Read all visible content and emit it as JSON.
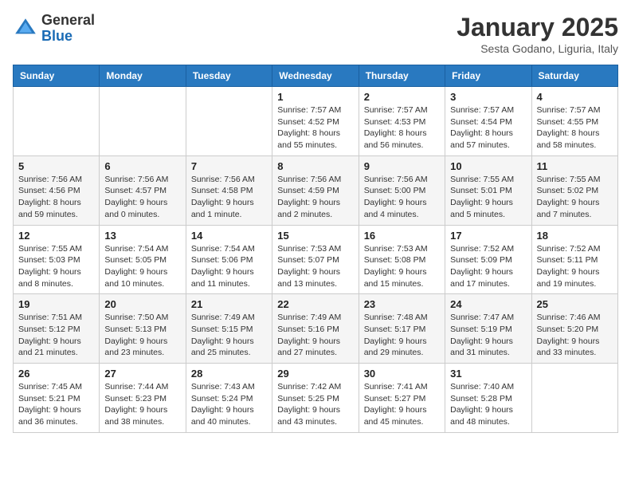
{
  "header": {
    "logo_general": "General",
    "logo_blue": "Blue",
    "month_title": "January 2025",
    "location": "Sesta Godano, Liguria, Italy"
  },
  "weekdays": [
    "Sunday",
    "Monday",
    "Tuesday",
    "Wednesday",
    "Thursday",
    "Friday",
    "Saturday"
  ],
  "weeks": [
    [
      {
        "day": "",
        "info": ""
      },
      {
        "day": "",
        "info": ""
      },
      {
        "day": "",
        "info": ""
      },
      {
        "day": "1",
        "info": "Sunrise: 7:57 AM\nSunset: 4:52 PM\nDaylight: 8 hours\nand 55 minutes."
      },
      {
        "day": "2",
        "info": "Sunrise: 7:57 AM\nSunset: 4:53 PM\nDaylight: 8 hours\nand 56 minutes."
      },
      {
        "day": "3",
        "info": "Sunrise: 7:57 AM\nSunset: 4:54 PM\nDaylight: 8 hours\nand 57 minutes."
      },
      {
        "day": "4",
        "info": "Sunrise: 7:57 AM\nSunset: 4:55 PM\nDaylight: 8 hours\nand 58 minutes."
      }
    ],
    [
      {
        "day": "5",
        "info": "Sunrise: 7:56 AM\nSunset: 4:56 PM\nDaylight: 8 hours\nand 59 minutes."
      },
      {
        "day": "6",
        "info": "Sunrise: 7:56 AM\nSunset: 4:57 PM\nDaylight: 9 hours\nand 0 minutes."
      },
      {
        "day": "7",
        "info": "Sunrise: 7:56 AM\nSunset: 4:58 PM\nDaylight: 9 hours\nand 1 minute."
      },
      {
        "day": "8",
        "info": "Sunrise: 7:56 AM\nSunset: 4:59 PM\nDaylight: 9 hours\nand 2 minutes."
      },
      {
        "day": "9",
        "info": "Sunrise: 7:56 AM\nSunset: 5:00 PM\nDaylight: 9 hours\nand 4 minutes."
      },
      {
        "day": "10",
        "info": "Sunrise: 7:55 AM\nSunset: 5:01 PM\nDaylight: 9 hours\nand 5 minutes."
      },
      {
        "day": "11",
        "info": "Sunrise: 7:55 AM\nSunset: 5:02 PM\nDaylight: 9 hours\nand 7 minutes."
      }
    ],
    [
      {
        "day": "12",
        "info": "Sunrise: 7:55 AM\nSunset: 5:03 PM\nDaylight: 9 hours\nand 8 minutes."
      },
      {
        "day": "13",
        "info": "Sunrise: 7:54 AM\nSunset: 5:05 PM\nDaylight: 9 hours\nand 10 minutes."
      },
      {
        "day": "14",
        "info": "Sunrise: 7:54 AM\nSunset: 5:06 PM\nDaylight: 9 hours\nand 11 minutes."
      },
      {
        "day": "15",
        "info": "Sunrise: 7:53 AM\nSunset: 5:07 PM\nDaylight: 9 hours\nand 13 minutes."
      },
      {
        "day": "16",
        "info": "Sunrise: 7:53 AM\nSunset: 5:08 PM\nDaylight: 9 hours\nand 15 minutes."
      },
      {
        "day": "17",
        "info": "Sunrise: 7:52 AM\nSunset: 5:09 PM\nDaylight: 9 hours\nand 17 minutes."
      },
      {
        "day": "18",
        "info": "Sunrise: 7:52 AM\nSunset: 5:11 PM\nDaylight: 9 hours\nand 19 minutes."
      }
    ],
    [
      {
        "day": "19",
        "info": "Sunrise: 7:51 AM\nSunset: 5:12 PM\nDaylight: 9 hours\nand 21 minutes."
      },
      {
        "day": "20",
        "info": "Sunrise: 7:50 AM\nSunset: 5:13 PM\nDaylight: 9 hours\nand 23 minutes."
      },
      {
        "day": "21",
        "info": "Sunrise: 7:49 AM\nSunset: 5:15 PM\nDaylight: 9 hours\nand 25 minutes."
      },
      {
        "day": "22",
        "info": "Sunrise: 7:49 AM\nSunset: 5:16 PM\nDaylight: 9 hours\nand 27 minutes."
      },
      {
        "day": "23",
        "info": "Sunrise: 7:48 AM\nSunset: 5:17 PM\nDaylight: 9 hours\nand 29 minutes."
      },
      {
        "day": "24",
        "info": "Sunrise: 7:47 AM\nSunset: 5:19 PM\nDaylight: 9 hours\nand 31 minutes."
      },
      {
        "day": "25",
        "info": "Sunrise: 7:46 AM\nSunset: 5:20 PM\nDaylight: 9 hours\nand 33 minutes."
      }
    ],
    [
      {
        "day": "26",
        "info": "Sunrise: 7:45 AM\nSunset: 5:21 PM\nDaylight: 9 hours\nand 36 minutes."
      },
      {
        "day": "27",
        "info": "Sunrise: 7:44 AM\nSunset: 5:23 PM\nDaylight: 9 hours\nand 38 minutes."
      },
      {
        "day": "28",
        "info": "Sunrise: 7:43 AM\nSunset: 5:24 PM\nDaylight: 9 hours\nand 40 minutes."
      },
      {
        "day": "29",
        "info": "Sunrise: 7:42 AM\nSunset: 5:25 PM\nDaylight: 9 hours\nand 43 minutes."
      },
      {
        "day": "30",
        "info": "Sunrise: 7:41 AM\nSunset: 5:27 PM\nDaylight: 9 hours\nand 45 minutes."
      },
      {
        "day": "31",
        "info": "Sunrise: 7:40 AM\nSunset: 5:28 PM\nDaylight: 9 hours\nand 48 minutes."
      },
      {
        "day": "",
        "info": ""
      }
    ]
  ]
}
